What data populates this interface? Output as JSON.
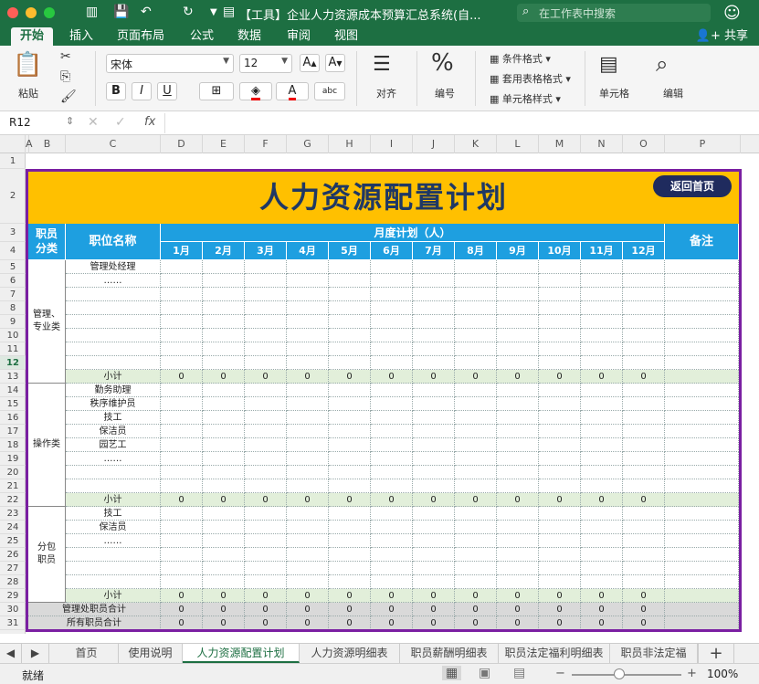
{
  "window": {
    "title": "【工具】企业人力资源成本预算汇总系统(自...",
    "search_placeholder": "在工作表中搜索",
    "share_label": "共享"
  },
  "ribbon": {
    "tabs": [
      "开始",
      "插入",
      "页面布局",
      "公式",
      "数据",
      "审阅",
      "视图"
    ],
    "active_tab": "开始",
    "paste_label": "粘贴",
    "font_name": "宋体",
    "font_size": "12",
    "bold": "B",
    "italic": "I",
    "underline": "U",
    "align_label": "对齐",
    "number_label": "编号",
    "number_icon": "%",
    "cond_format": "条件格式",
    "table_format": "套用表格格式",
    "cell_style": "单元格样式",
    "cells_label": "单元格",
    "edit_label": "编辑"
  },
  "formula_bar": {
    "name_box": "R12",
    "fx": "fx",
    "value": ""
  },
  "columns": [
    "A",
    "B",
    "C",
    "D",
    "E",
    "F",
    "G",
    "H",
    "I",
    "J",
    "K",
    "L",
    "M",
    "N",
    "O",
    "P"
  ],
  "sheet": {
    "title": "人力资源配置计划",
    "back_button": "返回首页",
    "header": {
      "category": "职员\n分类",
      "position": "职位名称",
      "monthly": "月度计划（人）",
      "months": [
        "1月",
        "2月",
        "3月",
        "4月",
        "5月",
        "6月",
        "7月",
        "8月",
        "9月",
        "10月",
        "11月",
        "12月"
      ],
      "remark": "备注"
    },
    "groups": [
      {
        "category": "管理、\n专业类",
        "positions": [
          "管理处经理",
          "……",
          "",
          "",
          "",
          "",
          "",
          ""
        ],
        "subtotal_label": "小计",
        "subtotal_values": [
          0,
          0,
          0,
          0,
          0,
          0,
          0,
          0,
          0,
          0,
          0,
          0
        ]
      },
      {
        "category": "操作类",
        "positions": [
          "勤务助理",
          "秩序维护员",
          "技工",
          "保洁员",
          "园艺工",
          "……",
          "",
          ""
        ],
        "subtotal_label": "小计",
        "subtotal_values": [
          0,
          0,
          0,
          0,
          0,
          0,
          0,
          0,
          0,
          0,
          0,
          0
        ]
      },
      {
        "category": "分包\n职员",
        "positions": [
          "技工",
          "保洁员",
          "……",
          "",
          "",
          ""
        ],
        "subtotal_label": "小计",
        "subtotal_values": [
          0,
          0,
          0,
          0,
          0,
          0,
          0,
          0,
          0,
          0,
          0,
          0
        ]
      }
    ],
    "totals": [
      {
        "label": "管理处职员合计",
        "values": [
          0,
          0,
          0,
          0,
          0,
          0,
          0,
          0,
          0,
          0,
          0,
          0
        ]
      },
      {
        "label": "所有职员合计",
        "values": [
          0,
          0,
          0,
          0,
          0,
          0,
          0,
          0,
          0,
          0,
          0,
          0
        ]
      }
    ],
    "row_numbers": [
      "1",
      "2",
      "3",
      "4",
      "5",
      "6",
      "7",
      "8",
      "9",
      "10",
      "11",
      "12",
      "13",
      "14",
      "15",
      "16",
      "17",
      "18",
      "19",
      "20",
      "21",
      "22",
      "23",
      "24",
      "25",
      "26",
      "27",
      "28",
      "29",
      "30",
      "31"
    ],
    "selected_row": "12"
  },
  "sheet_tabs": [
    "首页",
    "使用说明",
    "人力资源配置计划",
    "人力资源明细表",
    "职员薪酬明细表",
    "职员法定福利明细表",
    "职员非法定福"
  ],
  "active_sheet": "人力资源配置计划",
  "status": {
    "ready": "就绪",
    "zoom": "100%"
  },
  "colors": {
    "brand": "#1d6f42",
    "title_bg": "#ffc000",
    "header_bg": "#1e9fe0",
    "frame": "#7a1fa2",
    "title_text": "#1f3864"
  }
}
